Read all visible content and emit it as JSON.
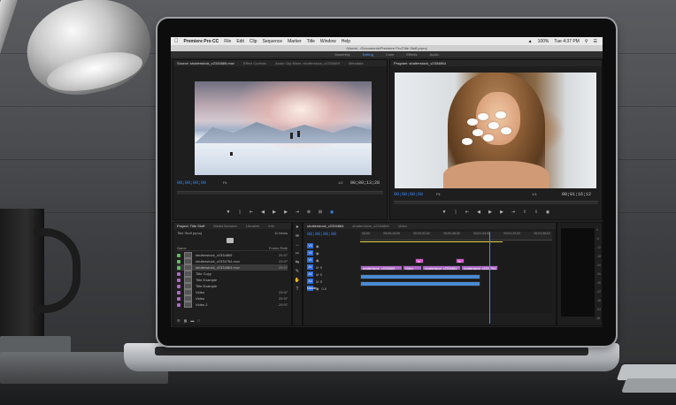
{
  "menubar": {
    "app_name": "Premiere Pro CC",
    "items": [
      "File",
      "Edit",
      "Clip",
      "Sequence",
      "Marker",
      "Title",
      "Window",
      "Help"
    ],
    "battery": "100%",
    "clock": "Tue 4:37 PM"
  },
  "titlebar": "/Users/.../Documents/Premiere Pro/Title Stuff.prproj",
  "workspaces": {
    "items": [
      "Assembly",
      "Editing",
      "Color",
      "Effects",
      "Audio"
    ],
    "active": "Editing"
  },
  "source_panel": {
    "tabs": [
      "Source: shutterstock_v2334869.mov",
      "Effect Controls",
      "Audio Clip Mixer: shutterstock_v2334869",
      "Metadata"
    ],
    "timecode_in": "00;00;00;00",
    "fit": "Fit",
    "fraction": "1/2",
    "timecode_out": "00;00;13;28"
  },
  "program_panel": {
    "tabs": [
      "Program: shutterstock_v2334864"
    ],
    "timecode_in": "00;00;00;00",
    "fit": "Fit",
    "fraction": "1/4",
    "timecode_out": "00;01;16;12"
  },
  "project_panel": {
    "tabs": [
      "Project: Title Stuff",
      "Media Browser",
      "Libraries",
      "Info"
    ],
    "project_file": "Title Stuff.prproj",
    "item_count": "11 Items",
    "col_name": "Name",
    "col_rate": "Frame Rate",
    "items": [
      {
        "name": "shutterstock_v2334869",
        "dur": "29.97",
        "color": "#5fbf5f"
      },
      {
        "name": "shutterstock_v2334754.mov",
        "dur": "29.97",
        "color": "#5fbf5f"
      },
      {
        "name": "shutterstock_v2334864.mov",
        "dur": "29.97",
        "color": "#5fbf5f"
      },
      {
        "name": "Title Copy",
        "dur": "",
        "color": "#b06ac9"
      },
      {
        "name": "Title Example",
        "dur": "",
        "color": "#b06ac9"
      },
      {
        "name": "Title Example",
        "dur": "",
        "color": "#b06ac9"
      },
      {
        "name": "Video",
        "dur": "29.97",
        "color": "#b06ac9"
      },
      {
        "name": "Video",
        "dur": "29.97",
        "color": "#b06ac9"
      },
      {
        "name": "Video 2",
        "dur": "29.97",
        "color": "#b06ac9"
      }
    ]
  },
  "timeline": {
    "tabs": [
      "shutterstock_v2334864",
      "shutterstock_v2334869",
      "Video"
    ],
    "timecode": "00;00;00;00",
    "ruler": [
      "00;00",
      "00;00;16;00",
      "00;00;32;00",
      "00;00;48;00",
      "00;01;04;02",
      "00;01;20;02",
      "00;01;36;02"
    ],
    "tracks": [
      "V3",
      "V2",
      "V1",
      "A1",
      "A2",
      "A3",
      "Master"
    ],
    "master_value": "0.0",
    "clips": [
      {
        "label": "shutterstock_v2334869",
        "kind": "v"
      },
      {
        "label": "fx",
        "kind": "fx"
      },
      {
        "label": "fx",
        "kind": "fx"
      },
      {
        "label": "Video",
        "kind": "v"
      },
      {
        "label": "shutterstock_v2334864",
        "kind": "v"
      },
      {
        "label": "shutterstock_v2334754",
        "kind": "v"
      },
      {
        "label": "",
        "kind": "a"
      },
      {
        "label": "",
        "kind": "a"
      }
    ]
  },
  "meters": {
    "ticks": [
      "0",
      "-6",
      "-12",
      "-18",
      "-24",
      "-30",
      "-36",
      "-42",
      "-48",
      "-54",
      "dB"
    ]
  }
}
